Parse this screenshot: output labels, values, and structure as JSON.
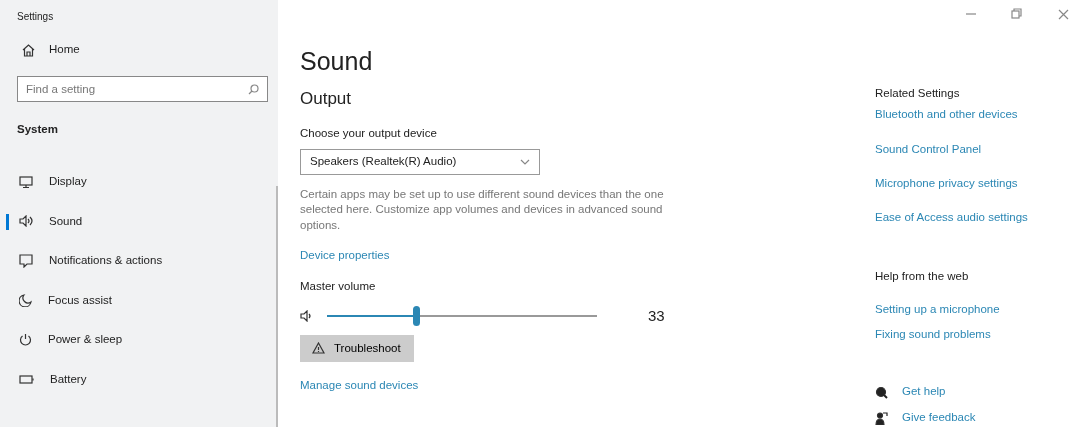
{
  "window": {
    "title": "Settings",
    "controls": [
      {
        "kind": "minimize"
      },
      {
        "kind": "restore"
      },
      {
        "kind": "close"
      }
    ]
  },
  "sidebar": {
    "home": "Home",
    "search": {
      "placeholder": "Find a setting"
    },
    "section": "System",
    "items": [
      {
        "label": "Display",
        "kind": "display",
        "selected": false
      },
      {
        "label": "Sound",
        "kind": "sound",
        "selected": true
      },
      {
        "label": "Notifications & actions",
        "kind": "notifications",
        "selected": false
      },
      {
        "label": "Focus assist",
        "kind": "moon",
        "selected": false
      },
      {
        "label": "Power & sleep",
        "kind": "power",
        "selected": false
      },
      {
        "label": "Battery",
        "kind": "battery",
        "selected": false
      }
    ]
  },
  "main": {
    "title": "Sound",
    "section": "Output",
    "device_label": "Choose your output device",
    "device": "Speakers (Realtek(R) Audio)",
    "description": "Certain apps may be set up to use different sound devices than the one selected here. Customize app volumes and devices in advanced sound options.",
    "device_link": "Device properties",
    "volume_label": "Master volume",
    "volume": {
      "level": 0.33,
      "reading": "33"
    },
    "troubleshoot": "Troubleshoot",
    "manage_link": "Manage sound devices"
  },
  "related": {
    "title": "Related Settings",
    "links": [
      "Bluetooth and other devices",
      "Sound Control Panel",
      "Microphone privacy settings",
      "Ease of Access audio settings"
    ]
  },
  "help": {
    "title": "Help from the web",
    "links": [
      "Setting up a microphone",
      "Fixing sound problems"
    ]
  },
  "footer": [
    {
      "kind": "help",
      "label": "Get help"
    },
    {
      "kind": "feedback",
      "label": "Give feedback"
    }
  ]
}
